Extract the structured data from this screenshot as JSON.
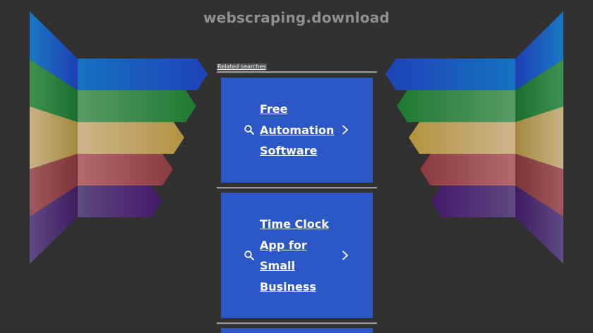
{
  "domain": "webscraping.download",
  "related_label": "Related searches",
  "cards": [
    {
      "lines": [
        "Free",
        "Automation",
        "Software"
      ]
    },
    {
      "lines": [
        "Time Clock",
        "App for",
        "Small",
        "Business"
      ]
    },
    {
      "lines": []
    }
  ],
  "colors": {
    "background": "#313131",
    "card": "#2c57c7",
    "bands": [
      "#1a4fc0",
      "#248a3a",
      "#bfa060",
      "#a84c52",
      "#4b2670"
    ]
  },
  "icons": {
    "card_left": "search-icon",
    "card_right": "chevron-right-icon"
  }
}
